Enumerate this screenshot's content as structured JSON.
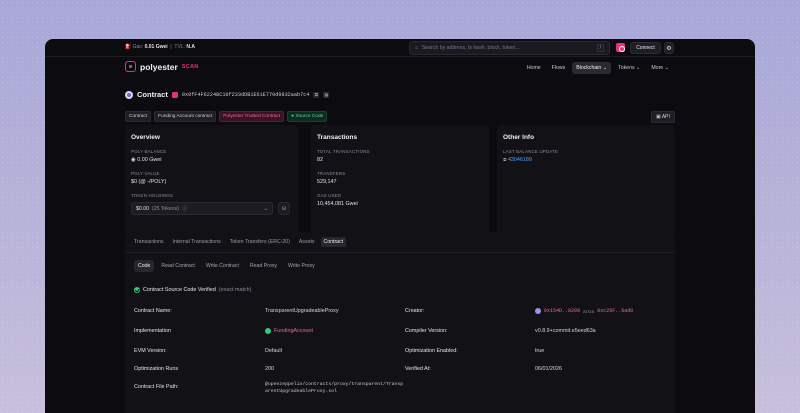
{
  "topbar": {
    "gas_label": "Gas:",
    "gas_value": "0.01 Gwei",
    "tvl_label": "TVL:",
    "tvl_value": "N.A",
    "search_placeholder": "Search by address, tx hash, block, token...",
    "search_shortcut": "/",
    "connect_label": "Connect",
    "settings_icon": "gear-icon"
  },
  "brand": {
    "name": "polyester",
    "tag": "SCAN"
  },
  "nav": {
    "items": [
      "Home",
      "Flows",
      "Blockchain",
      "Tokens",
      "More"
    ],
    "active": "Blockchain"
  },
  "contract": {
    "title": "Contract",
    "address": "0x8fF4F6224BC10f233dDB1E61E770d9832aab7c4"
  },
  "tags": [
    "Contract",
    "Funding Account contract",
    "Polyester Trusted Contract",
    "Source Code"
  ],
  "api_label": "API",
  "overview": {
    "title": "Overview",
    "balance_label": "POLY BALANCE",
    "balance_value": "0.00 Gwei",
    "value_label": "POLY VALUE",
    "value_value": "$0 (@ -/POLY)",
    "holdings_label": "TOKEN HOLDINGS",
    "holdings_value": "$0.00",
    "holdings_count": "(25 Tokens)"
  },
  "transactions": {
    "title": "Transactions",
    "total_label": "TOTAL TRANSACTIONS",
    "total_value": "82",
    "transfers_label": "TRANSFERS",
    "transfers_value": "529,147",
    "gas_label": "GAS USED",
    "gas_value": "10,454,081 Gwei"
  },
  "other": {
    "title": "Other Info",
    "last_label": "LAST BALANCE UPDATE",
    "last_value": "43046189"
  },
  "tabs": [
    "Transactions",
    "Internal Transactions",
    "Token Transfers (ERC-20)",
    "Assets",
    "Contract"
  ],
  "active_tab": "Contract",
  "subtabs": [
    "Code",
    "Read Contract",
    "Write Contract",
    "Read Proxy",
    "Write Proxy"
  ],
  "active_subtab": "Code",
  "verified": {
    "text": "Contract Source Code Verified",
    "note": "(exact match)"
  },
  "details": {
    "name_label": "Contract Name:",
    "name_value": "TransparentUpgradeableProxy",
    "creator_label": "Creator:",
    "creator_addr": "0x154D..0209",
    "creator_at": "at txn",
    "creator_txn": "0xc26F..6ad0",
    "impl_label": "Implementation",
    "impl_value": "FundingAccount",
    "compiler_label": "Compiler Version:",
    "compiler_value": "v0.8.9+commit.e5eed63a",
    "evm_label": "EVM Version:",
    "evm_value": "Default",
    "opt_label": "Optimization Enabled:",
    "opt_value": "true",
    "runs_label": "Optimization Runs",
    "runs_value": "200",
    "verified_label": "Verified At:",
    "verified_value": "06/01/2026",
    "path_label": "Contract File Path:",
    "path_value": "@openzeppelin/contracts/proxy/transparent/TransparentUpgradeableProxy.sol"
  }
}
